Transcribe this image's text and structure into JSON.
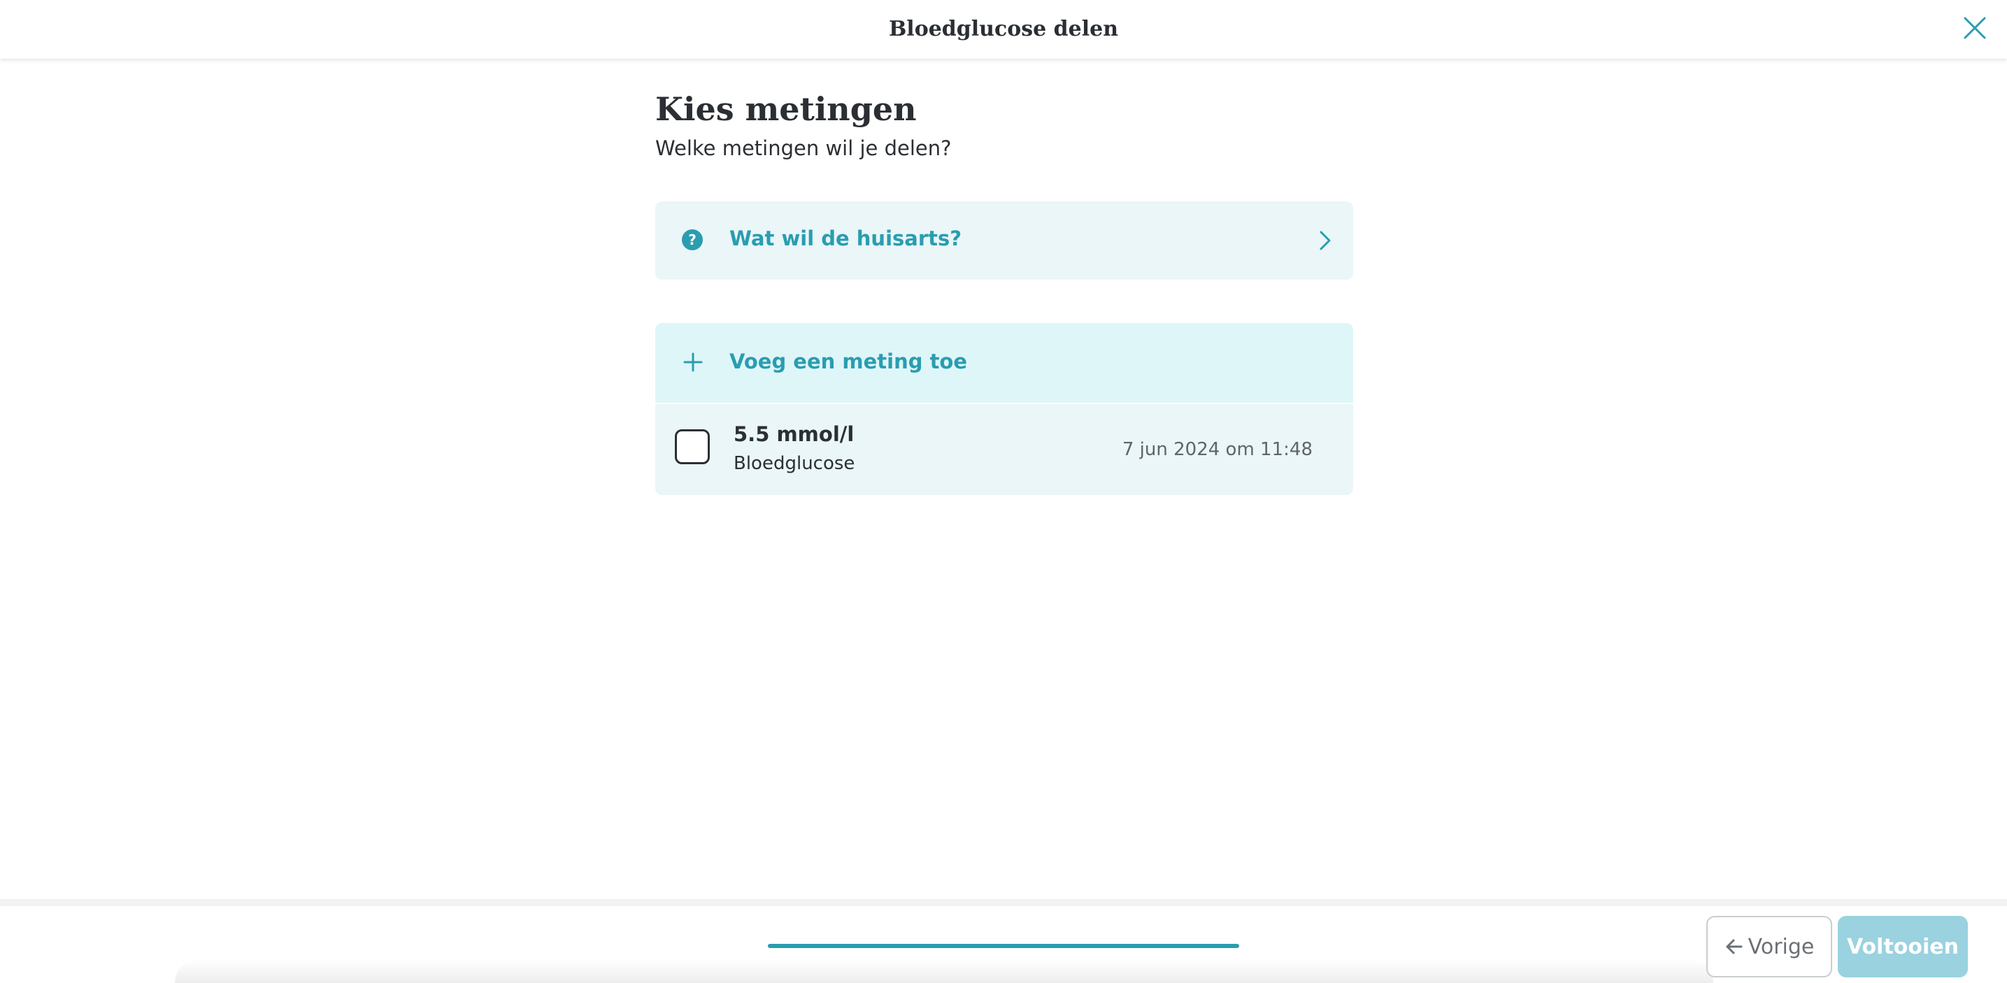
{
  "header": {
    "title": "Bloedglucose delen",
    "close_icon": "close-icon"
  },
  "main": {
    "title": "Kies metingen",
    "subtitle": "Welke metingen wil je delen?",
    "info_card": {
      "icon": "question-circle-icon",
      "label": "Wat wil de huisarts?",
      "chevron": "chevron-right-icon"
    },
    "add_measurement": {
      "icon": "plus-icon",
      "label": "Voeg een meting toe"
    },
    "measurements": [
      {
        "value": "5.5 mmol/l",
        "type": "Bloedglucose",
        "date": "7 jun 2024 om 11:48",
        "checked": false
      }
    ]
  },
  "footer": {
    "progress_fraction": 1.0,
    "prev_label": "Vorige",
    "prev_icon": "arrow-left-icon",
    "finish_label": "Voltooien"
  },
  "colors": {
    "accent": "#2a9db0",
    "card_bg": "#eaf6f8",
    "add_row_bg": "#dff6f9",
    "finish_button_bg": "#9ad2df"
  }
}
